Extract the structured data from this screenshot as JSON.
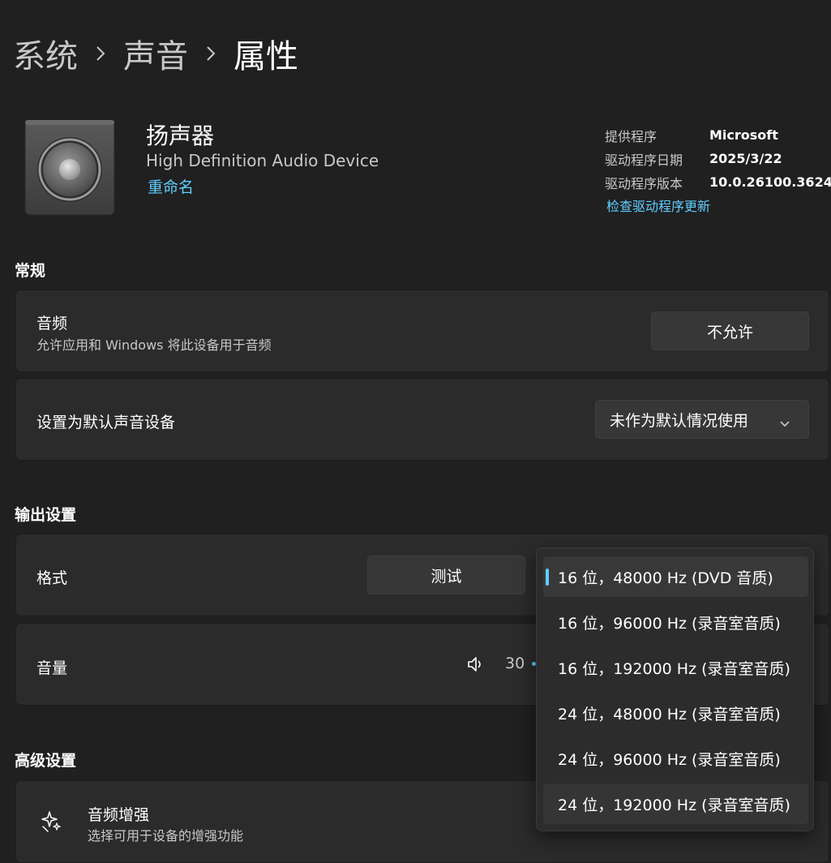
{
  "breadcrumb": {
    "items": [
      "系统",
      "声音"
    ],
    "current": "属性"
  },
  "device": {
    "name": "扬声器",
    "subtitle": "High Definition Audio Device",
    "rename_link": "重命名"
  },
  "driver": {
    "rows": [
      {
        "key": "提供程序",
        "value": "Microsoft"
      },
      {
        "key": "驱动程序日期",
        "value": "2025/3/22"
      },
      {
        "key": "驱动程序版本",
        "value": "10.0.26100.3624"
      }
    ],
    "update_link": "检查驱动程序更新"
  },
  "general": {
    "title": "常规",
    "audio": {
      "title": "音频",
      "description": "允许应用和 Windows 将此设备用于音频",
      "button": "不允许"
    },
    "default_device": {
      "title": "设置为默认声音设备",
      "selected": "未作为默认情况使用"
    }
  },
  "output": {
    "title": "输出设置",
    "format": {
      "title": "格式",
      "test_button": "测试"
    },
    "volume": {
      "title": "音量",
      "value": "30"
    }
  },
  "advanced": {
    "title": "高级设置",
    "enhancement": {
      "title": "音频增强",
      "description": "选择可用于设备的增强功能"
    }
  },
  "format_dropdown": {
    "options": [
      "16 位，48000 Hz (DVD 音质)",
      "16 位，96000 Hz (录音室音质)",
      "16 位，192000 Hz (录音室音质)",
      "24 位，48000 Hz (录音室音质)",
      "24 位，96000 Hz (录音室音质)",
      "24 位，192000 Hz (录音室音质)"
    ],
    "selected_index": 0
  },
  "colors": {
    "accent": "#60cdff",
    "background": "#202020",
    "card": "#2b2b2b"
  },
  "icons": [
    "chevron-right-icon",
    "speaker-device-icon",
    "chevron-down-icon",
    "volume-icon",
    "sparkle-icon"
  ]
}
